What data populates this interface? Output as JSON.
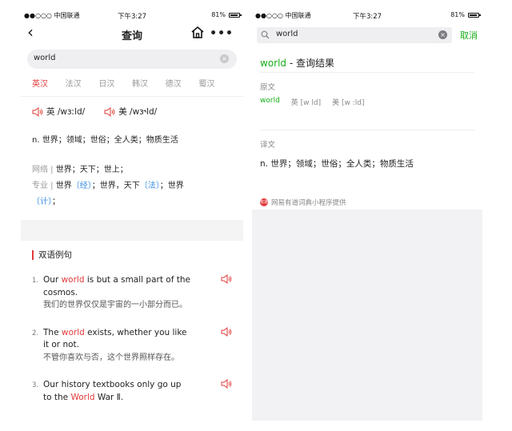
{
  "status": {
    "carrier": "●●○○○ 中国联通",
    "time": "下午3:27",
    "battery": "81%"
  },
  "left": {
    "nav": {
      "title": "查询",
      "back": "‹",
      "more": "•••"
    },
    "search": {
      "value": "world"
    },
    "tabs": [
      {
        "label": "英汉",
        "active": true
      },
      {
        "label": "法汉"
      },
      {
        "label": "日汉"
      },
      {
        "label": "韩汉"
      },
      {
        "label": "德汉"
      },
      {
        "label": "蜀汉"
      }
    ],
    "phon": {
      "uk": "英 /wɜːld/",
      "us": "美 /wɜ˞ld/"
    },
    "definition": "n. 世界；领域；世俗；全人类；物质生活",
    "net_label": "网络 | ",
    "net_text": "世界；天下；世上；",
    "pro_label": "专业 | ",
    "pro_a": "世界",
    "pro_b": "〔经〕",
    "pro_c": "；世界，天下",
    "pro_d": "〔法〕",
    "pro_e": "；世界",
    "pro_f": "〔计〕",
    "pro_g": "；",
    "examples_title": "双语例句",
    "examples": [
      {
        "num": "1.",
        "pre": "Our ",
        "hl": "world",
        "post": " is but a small part of the cosmos.",
        "zh": "我们的世界仅仅是宇宙的一小部分而已。"
      },
      {
        "num": "2.",
        "pre": "The ",
        "hl": "world",
        "post": " exists, whether you like it or not.",
        "zh": "不管你喜欢与否，这个世界照样存在。"
      },
      {
        "num": "3.",
        "pre": "Our history textbooks only go up to the ",
        "hl": "World",
        "post": " War Ⅱ.",
        "zh": ""
      }
    ]
  },
  "right": {
    "search": {
      "value": "world",
      "cancel": "取消"
    },
    "title_g": "world",
    "title_rest": " - 查询结果",
    "orig_label": "原文",
    "orig_word": "world",
    "orig_uk": "英 [w    ld]",
    "orig_us": "美 [w    :ld]",
    "trans_label": "译文",
    "trans_text": "n. 世界；领域；世俗；全人类；物质生活",
    "footer": "网易有道词典小程序提供",
    "footer_logo": "有道"
  },
  "colors": {
    "accent_red": "#e23a3a",
    "accent_green": "#1aad19",
    "link_blue": "#3a8ee6"
  }
}
